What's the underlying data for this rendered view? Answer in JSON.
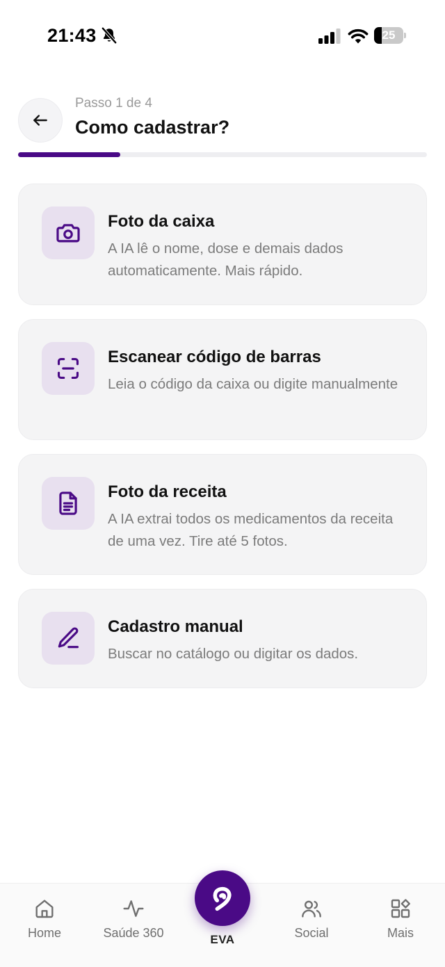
{
  "status_bar": {
    "time": "21:43",
    "battery_level": "25",
    "battery_fraction": 0.25
  },
  "header": {
    "step": "Passo 1 de 4",
    "title": "Como cadastrar?",
    "progress": 0.25
  },
  "options": [
    {
      "icon": "camera-icon",
      "title": "Foto da caixa",
      "description": "A IA lê o nome, dose e demais dados automaticamente. Mais rápido."
    },
    {
      "icon": "barcode-scan-icon",
      "title": "Escanear código de barras",
      "description": "Leia o código da caixa ou digite manualmente"
    },
    {
      "icon": "document-icon",
      "title": "Foto da receita",
      "description": "A IA extrai todos os medicamentos da receita de uma vez. Tire até 5 fotos."
    },
    {
      "icon": "pencil-icon",
      "title": "Cadastro manual",
      "description": "Buscar no catálogo ou digitar os dados."
    }
  ],
  "nav": {
    "home": "Home",
    "health": "Saúde 360",
    "eva": "EVA",
    "social": "Social",
    "more": "Mais"
  },
  "colors": {
    "accent": "#4a0a86",
    "icon_bg": "#e8e0ef",
    "card_bg": "#f4f4f5"
  }
}
